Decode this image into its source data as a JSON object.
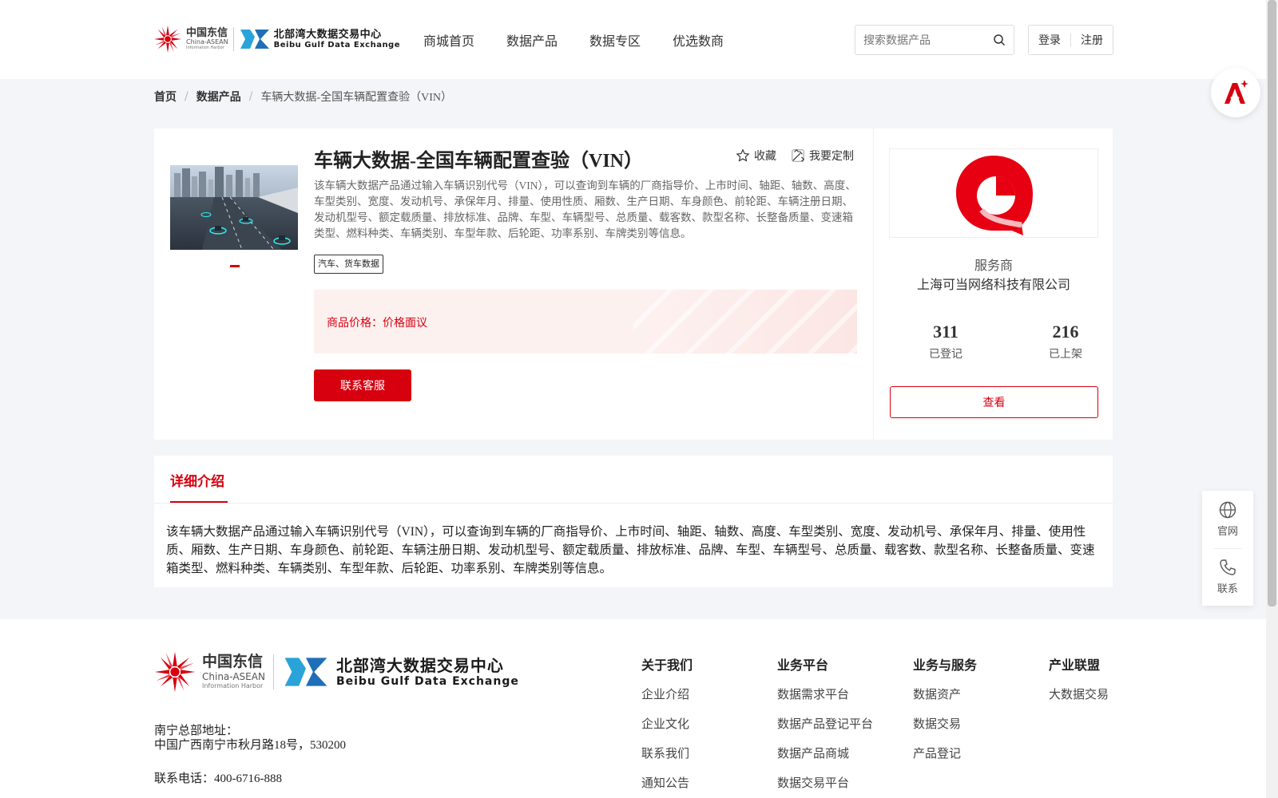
{
  "header": {
    "logo_left": {
      "line1": "中国东信",
      "line2": "China-ASEAN",
      "line3": "Information Harbor"
    },
    "logo_right": {
      "line1": "北部湾大数据交易中心",
      "line2": "Beibu Gulf Data Exchange"
    },
    "nav": [
      "商城首页",
      "数据产品",
      "数据专区",
      "优选数商"
    ],
    "search_placeholder": "搜索数据产品",
    "login": "登录",
    "register": "注册"
  },
  "breadcrumb": [
    "首页",
    "数据产品",
    "车辆大数据-全国车辆配置查验（VIN）"
  ],
  "product": {
    "title": "车辆大数据-全国车辆配置查验（VIN）",
    "favorite": "收藏",
    "customize": "我要定制",
    "description": "该车辆大数据产品通过输入车辆识别代号（VIN），可以查询到车辆的厂商指导价、上市时间、轴距、轴数、高度、车型类别、宽度、发动机号、承保年月、排量、使用性质、厢数、生产日期、车身颜色、前轮距、车辆注册日期、发动机型号、额定载质量、排放标准、品牌、车型、车辆型号、总质量、载客数、款型名称、长整备质量、变速箱类型、燃料种类、车辆类别、车型年款、后轮距、功率系别、车牌类别等信息。",
    "tag": "汽车、货车数据",
    "price_label": "商品价格：",
    "price_value": "价格面议",
    "contact_button": "联系客服"
  },
  "provider": {
    "label": "服务商",
    "name": "上海可当网络科技有限公司",
    "registered_count": "311",
    "registered_label": "已登记",
    "listed_count": "216",
    "listed_label": "已上架",
    "view_button": "查看"
  },
  "detail": {
    "tab": "详细介绍",
    "body": "该车辆大数据产品通过输入车辆识别代号（VIN），可以查询到车辆的厂商指导价、上市时间、轴距、轴数、高度、车型类别、宽度、发动机号、承保年月、排量、使用性质、厢数、生产日期、车身颜色、前轮距、车辆注册日期、发动机型号、额定载质量、排放标准、品牌、车型、车辆型号、总质量、载客数、款型名称、长整备质量、变速箱类型、燃料种类、车辆类别、车型年款、后轮距、功率系别、车牌类别等信息。"
  },
  "footer": {
    "address_label": "南宁总部地址：",
    "address": "中国广西南宁市秋月路18号，530200",
    "phone": "联系电话：400-6716-888",
    "columns": [
      {
        "title": "关于我们",
        "items": [
          "企业介绍",
          "企业文化",
          "联系我们",
          "通知公告"
        ]
      },
      {
        "title": "业务平台",
        "items": [
          "数据需求平台",
          "数据产品登记平台",
          "数据产品商城",
          "数据交易平台"
        ]
      },
      {
        "title": "业务与服务",
        "items": [
          "数据资产",
          "数据交易",
          "产品登记"
        ]
      },
      {
        "title": "产业联盟",
        "items": [
          "大数据交易"
        ]
      }
    ]
  },
  "float": {
    "official": "官网",
    "contact": "联系"
  },
  "colors": {
    "accent": "#d7000f",
    "bg": "#f4f5f8"
  }
}
